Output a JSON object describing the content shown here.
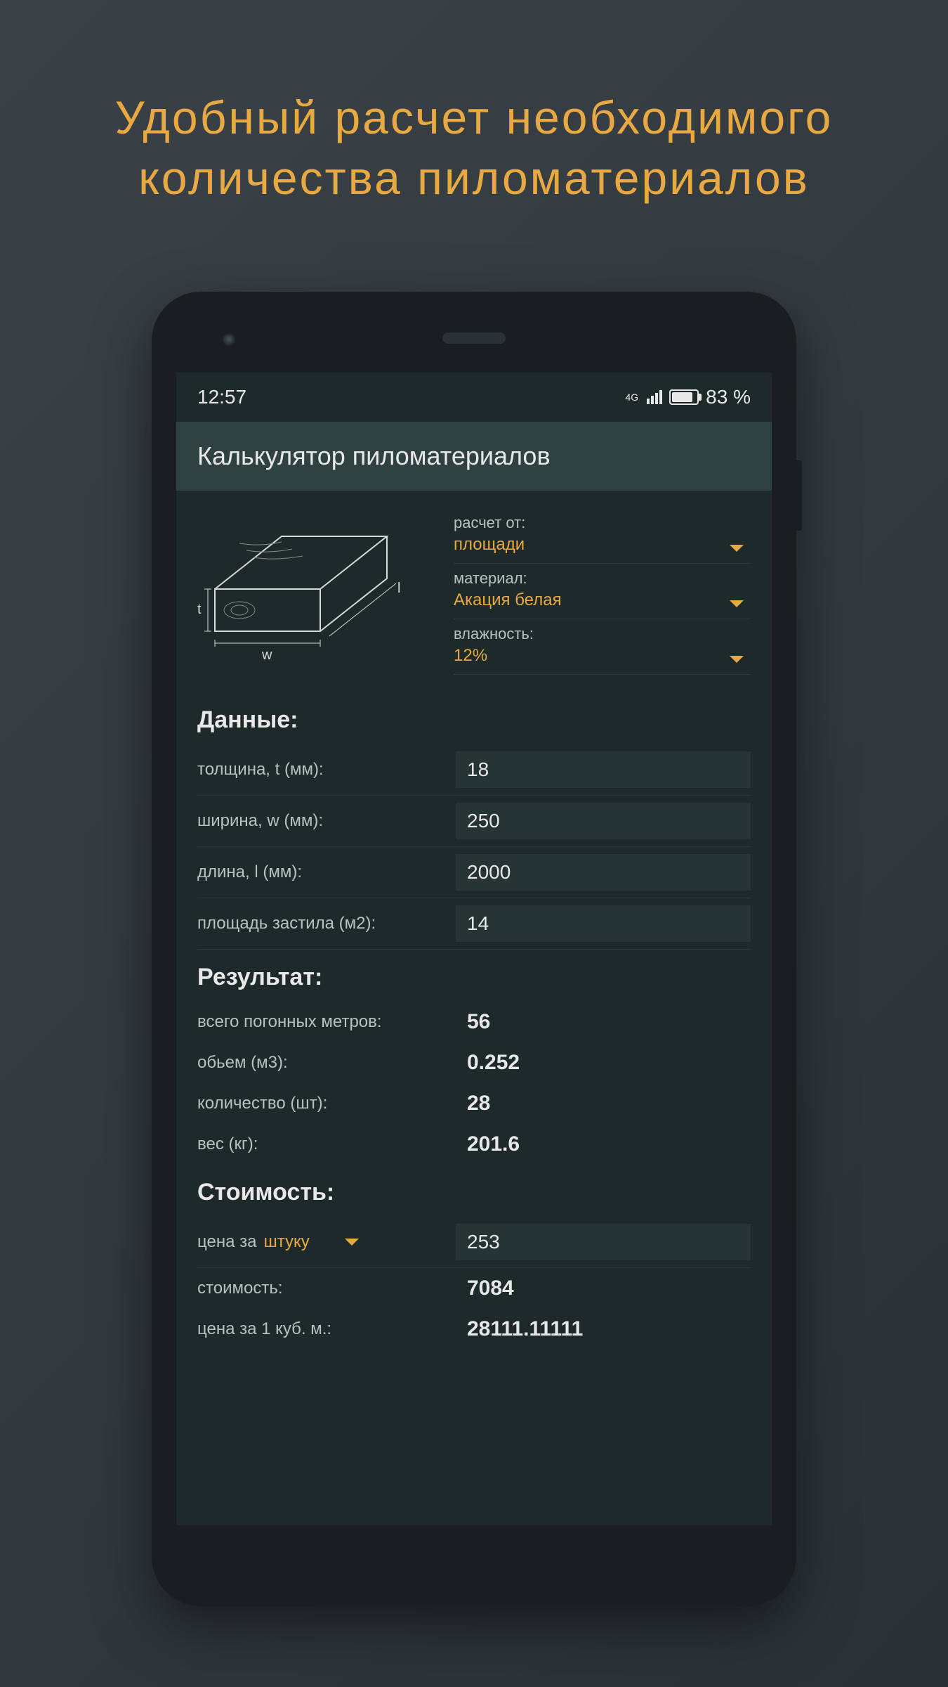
{
  "headline": "Удобный расчет необходимого количества пиломатериалов",
  "status": {
    "time": "12:57",
    "network": "4G",
    "battery": "83 %"
  },
  "app": {
    "title": "Калькулятор пиломатериалов"
  },
  "diagram": {
    "label_t": "t",
    "label_w": "w",
    "label_l": "l"
  },
  "config": {
    "calc_from": {
      "label": "расчет от:",
      "value": "площади"
    },
    "material": {
      "label": "материал:",
      "value": "Акация белая"
    },
    "humidity": {
      "label": "влажность:",
      "value": "12%"
    }
  },
  "data_section": {
    "title": "Данные:",
    "thickness": {
      "label": "толщина, t (мм):",
      "value": "18"
    },
    "width": {
      "label": "ширина, w (мм):",
      "value": "250"
    },
    "length": {
      "label": "длина, l (мм):",
      "value": "2000"
    },
    "area": {
      "label": "площадь застила (м2):",
      "value": "14"
    }
  },
  "result_section": {
    "title": "Результат:",
    "linear_meters": {
      "label": "всего погонных метров:",
      "value": "56"
    },
    "volume": {
      "label": "обьем (м3):",
      "value": "0.252"
    },
    "quantity": {
      "label": "количество (шт):",
      "value": "28"
    },
    "weight": {
      "label": "вес (кг):",
      "value": "201.6"
    }
  },
  "cost_section": {
    "title": "Стоимость:",
    "price_per": {
      "label": "цена за",
      "unit": "штуку",
      "value": "253"
    },
    "total_cost": {
      "label": "стоимость:",
      "value": "7084"
    },
    "price_per_cubic": {
      "label": "цена за 1 куб. м.:",
      "value": "28111.11111"
    }
  }
}
